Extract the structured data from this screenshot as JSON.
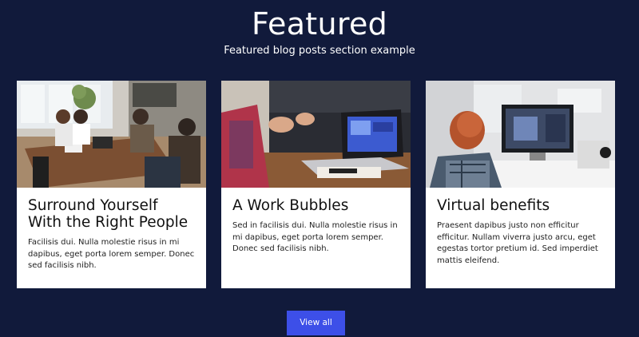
{
  "section": {
    "title": "Featured",
    "subtitle": "Featured blog posts section example"
  },
  "cards": [
    {
      "image": "office-team-meeting-photo",
      "title": "Surround Yourself With the Right People",
      "text": "Facilisis dui. Nulla molestie risus in mi dapibus, eget porta lorem semper. Donec sed facilisis nibh."
    },
    {
      "image": "laptop-discussion-photo",
      "title": "A Work Bubbles",
      "text": "Sed in facilisis dui. Nulla molestie risus in mi dapibus, eget porta lorem semper. Donec sed facilisis nibh."
    },
    {
      "image": "woman-at-desktop-photo",
      "title": "Virtual benefits",
      "text": "Praesent dapibus justo non efficitur efficitur. Nullam viverra justo arcu, eget egestas tortor pretium id. Sed imperdiet mattis eleifend."
    }
  ],
  "cta": {
    "label": "View all"
  },
  "colors": {
    "background": "#111a3b",
    "card": "#ffffff",
    "button": "#3d4fe8"
  }
}
